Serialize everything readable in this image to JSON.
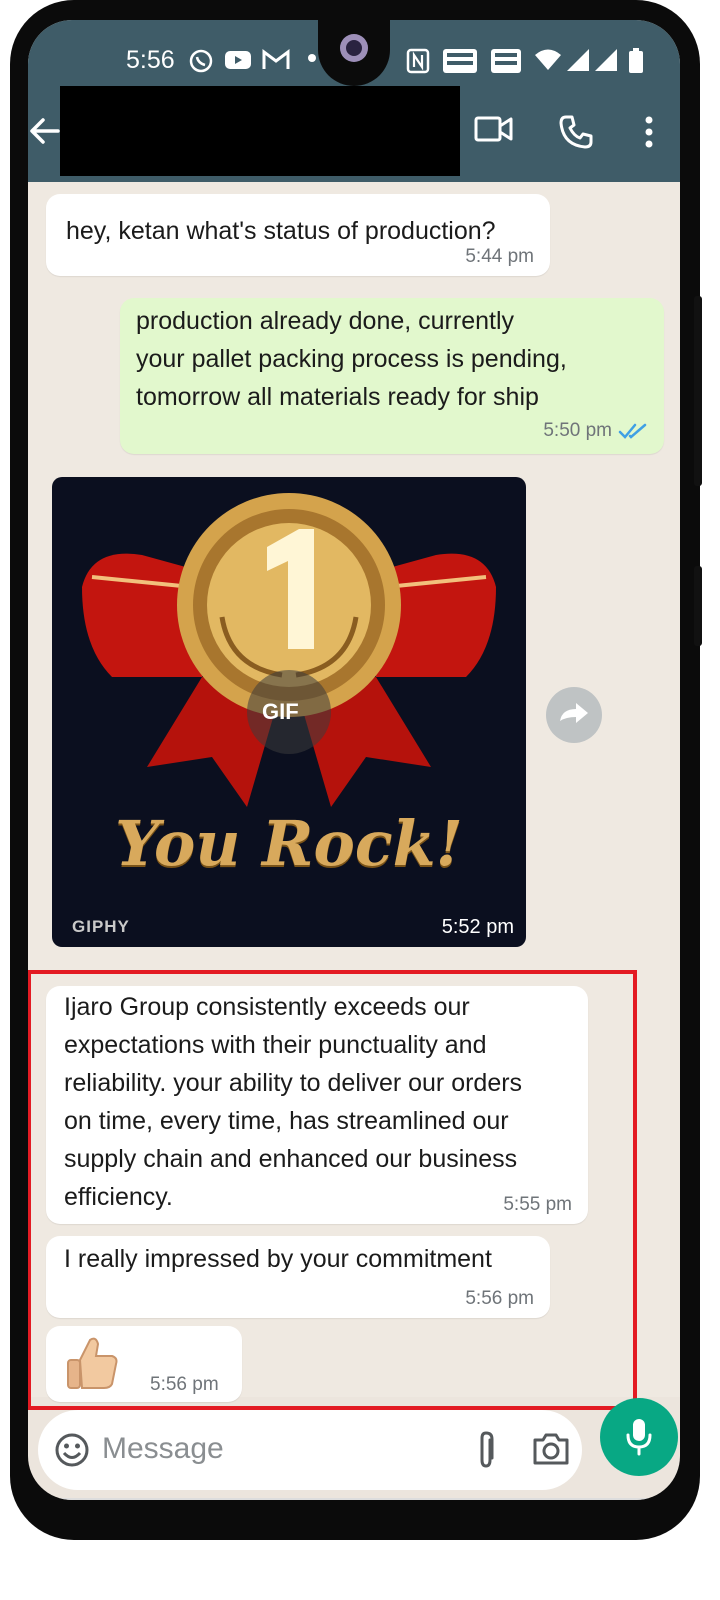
{
  "status_bar": {
    "time": "5:56"
  },
  "messages": [
    {
      "text": "hey, ketan what's status of production?",
      "time": "5:44 pm"
    },
    {
      "lines": [
        "production already done, currently",
        "your pallet packing process is pending,",
        "tomorrow all materials ready for ship"
      ],
      "time": "5:50 pm"
    },
    {
      "gif_label": "GIF",
      "gif_title": "You Rock!",
      "gif_source": "GIPHY",
      "time": "5:52 pm"
    },
    {
      "lines": [
        "Ijaro Group consistently exceeds our",
        "expectations with their punctuality and",
        "reliability. your ability to deliver our orders",
        "on time, every time, has streamlined our",
        "supply chain and enhanced our business",
        "efficiency."
      ],
      "time": "5:55 pm"
    },
    {
      "text": "I really impressed by your commitment",
      "time": "5:56 pm"
    },
    {
      "time": "5:56 pm"
    }
  ],
  "composer": {
    "placeholder": "Message"
  },
  "colors": {
    "header": "#3f5c68",
    "outgoing": "#e2f8cd",
    "accent": "#08a884",
    "highlight": "#e31b23"
  },
  "icons": [
    "back-icon",
    "video-call-icon",
    "voice-call-icon",
    "more-options-icon",
    "forward-icon",
    "emoji-icon",
    "attach-icon",
    "camera-icon",
    "mic-icon",
    "thumbs-up-emoji"
  ]
}
